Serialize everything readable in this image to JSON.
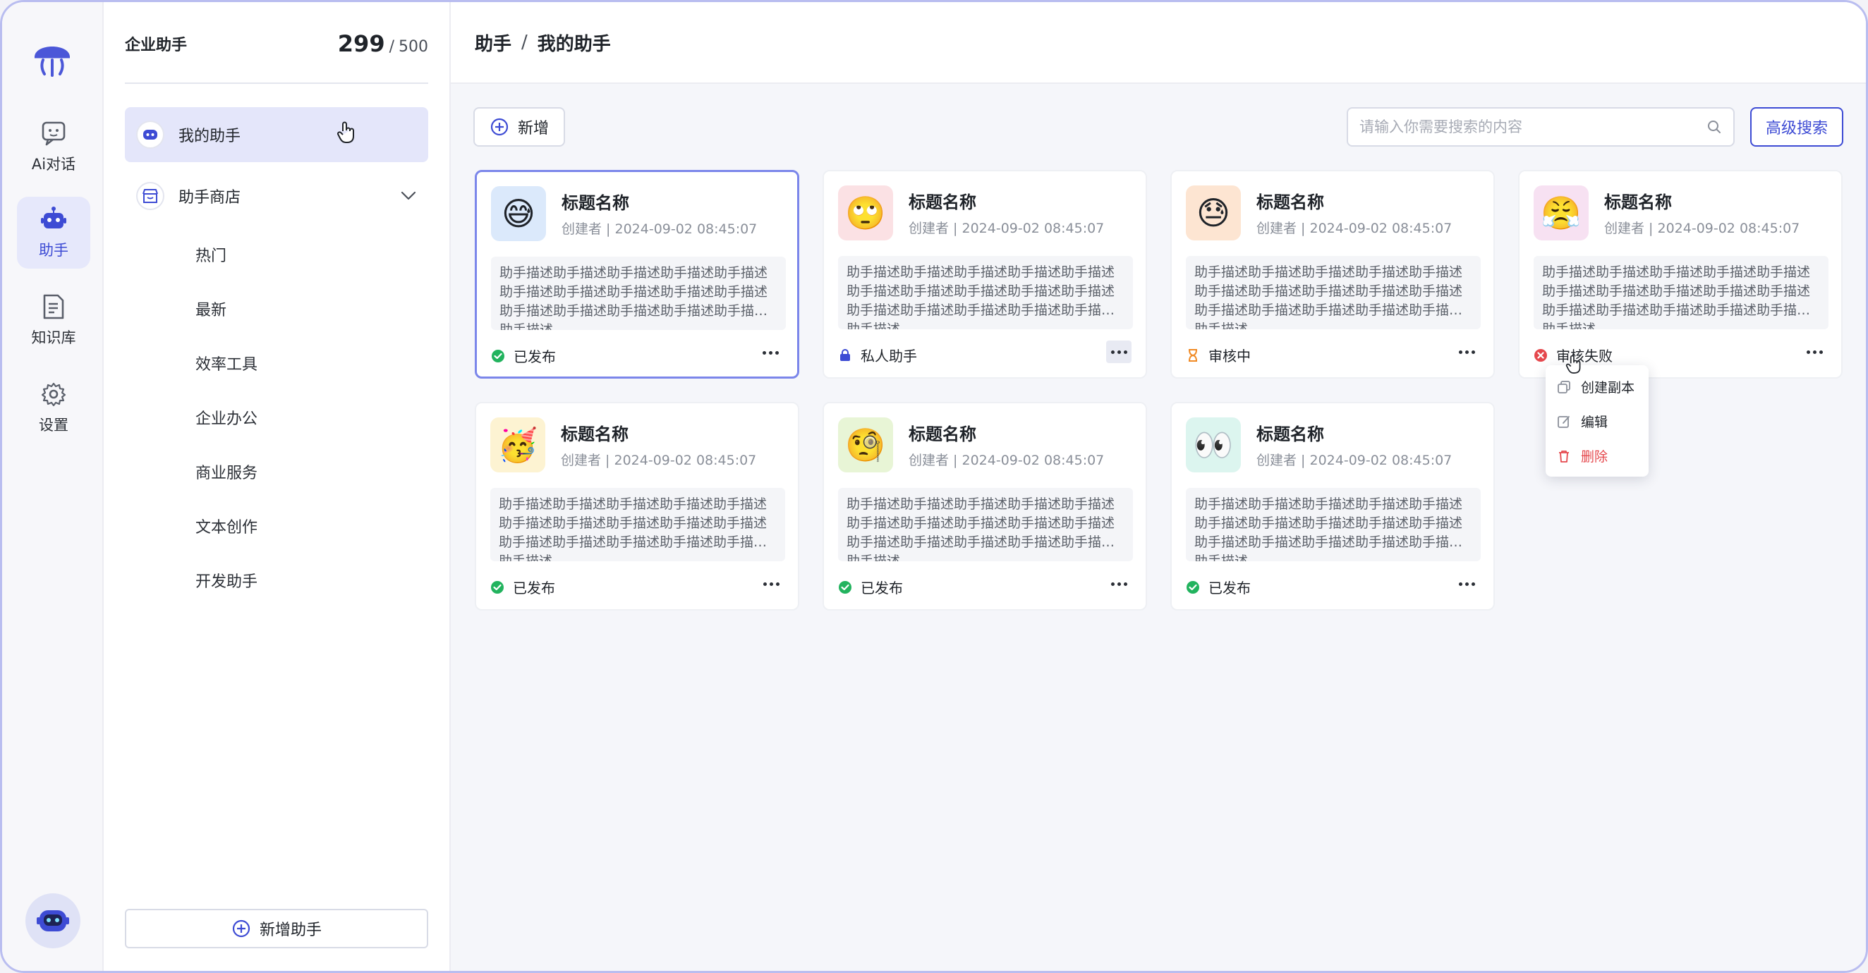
{
  "rail": {
    "logo_icon": "jellyfish-logo-icon",
    "items": [
      {
        "label": "Ai对话",
        "icon": "chat-bubble-icon",
        "active": false
      },
      {
        "label": "助手",
        "icon": "robot-icon",
        "active": true
      },
      {
        "label": "知识库",
        "icon": "document-icon",
        "active": false
      },
      {
        "label": "设置",
        "icon": "gear-icon",
        "active": false
      }
    ],
    "avatar_icon": "robot-avatar-icon"
  },
  "sidebar": {
    "title": "企业助手",
    "quota_used": "299",
    "quota_sep": "/",
    "quota_total": "500",
    "my_assistant": "我的助手",
    "store": "助手商店",
    "store_items": [
      "热门",
      "最新",
      "效率工具",
      "企业办公",
      "商业服务",
      "文本创作",
      "开发助手"
    ],
    "add_button": "新增助手"
  },
  "header": {
    "breadcrumb": [
      "助手",
      "我的助手"
    ],
    "separator": "/"
  },
  "toolbar": {
    "new_label": "新增",
    "search_placeholder": "请输入你需要搜索的内容",
    "advanced_search": "高级搜索"
  },
  "cards": [
    {
      "title": "标题名称",
      "meta": "创建者 | 2024-09-02 08:45:07",
      "desc": "助手描述助手描述助手描述助手描述助手描述助手描述助手描述助手描述助手描述助手描述助手描述助手描述助手描述助手描述助手描述助手描述",
      "status": "已发布",
      "status_type": "published",
      "emoji": "😅",
      "bg": "#dbe9fb"
    },
    {
      "title": "标题名称",
      "meta": "创建者 | 2024-09-02 08:45:07",
      "desc": "助手描述助手描述助手描述助手描述助手描述助手描述助手描述助手描述助手描述助手描述助手描述助手描述助手描述助手描述助手描述助手描述",
      "status": "私人助手",
      "status_type": "private",
      "emoji": "🙄",
      "bg": "#fbe1e4"
    },
    {
      "title": "标题名称",
      "meta": "创建者 | 2024-09-02 08:45:07",
      "desc": "助手描述助手描述助手描述助手描述助手描述助手描述助手描述助手描述助手描述助手描述助手描述助手描述助手描述助手描述助手描述助手描述",
      "status": "审核中",
      "status_type": "pending",
      "emoji": "😓",
      "bg": "#fde5d2"
    },
    {
      "title": "标题名称",
      "meta": "创建者 | 2024-09-02 08:45:07",
      "desc": "助手描述助手描述助手描述助手描述助手描述助手描述助手描述助手描述助手描述助手描述助手描述助手描述助手描述助手描述助手描述助手描述",
      "status": "审核失败",
      "status_type": "failed",
      "emoji": "😤",
      "bg": "#f7e1f2"
    },
    {
      "title": "标题名称",
      "meta": "创建者 | 2024-09-02 08:45:07",
      "desc": "助手描述助手描述助手描述助手描述助手描述助手描述助手描述助手描述助手描述助手描述助手描述助手描述助手描述助手描述助手描述助手描述",
      "status": "已发布",
      "status_type": "published",
      "emoji": "🥳",
      "bg": "#fdf3d2"
    },
    {
      "title": "标题名称",
      "meta": "创建者 | 2024-09-02 08:45:07",
      "desc": "助手描述助手描述助手描述助手描述助手描述助手描述助手描述助手描述助手描述助手描述助手描述助手描述助手描述助手描述助手描述助手描述",
      "status": "已发布",
      "status_type": "published",
      "emoji": "🧐",
      "bg": "#e8f5d6"
    },
    {
      "title": "标题名称",
      "meta": "创建者 | 2024-09-02 08:45:07",
      "desc": "助手描述助手描述助手描述助手描述助手描述助手描述助手描述助手描述助手描述助手描述助手描述助手描述助手描述助手描述助手描述助手描述",
      "status": "已发布",
      "status_type": "published",
      "emoji": "👀",
      "bg": "#dcf5ef"
    }
  ],
  "menu": {
    "copy": "创建副本",
    "edit": "编辑",
    "delete": "删除"
  },
  "colors": {
    "accent": "#3d4bd4",
    "published": "#22b35e",
    "private": "#3d4bd4",
    "pending": "#f08a24",
    "failed": "#e5484d"
  }
}
